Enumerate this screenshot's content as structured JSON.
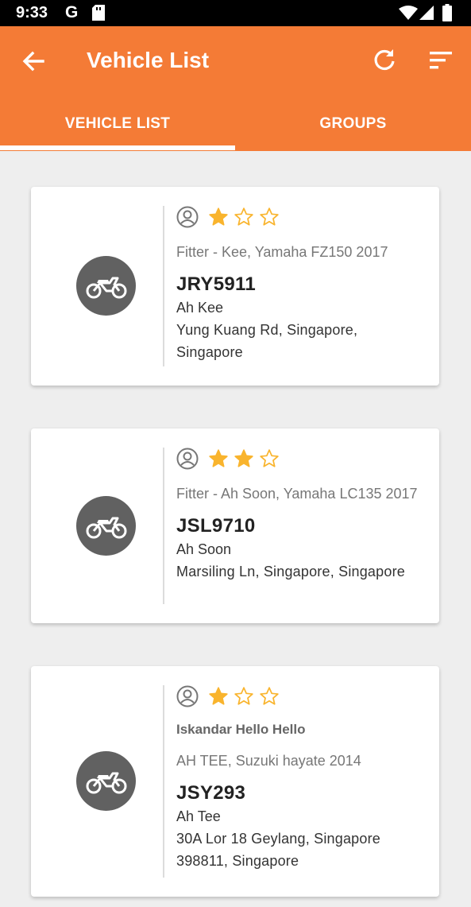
{
  "status_bar": {
    "time": "9:33",
    "g_label": "G",
    "icons": [
      "sd-card-icon",
      "wifi-icon",
      "signal-icon",
      "battery-icon"
    ]
  },
  "app_bar": {
    "title": "Vehicle List",
    "background_color": "#f47b36",
    "icons": [
      "back-arrow-icon",
      "refresh-icon",
      "sort-icon"
    ]
  },
  "tabs": [
    {
      "label": "VEHICLE LIST",
      "selected": true
    },
    {
      "label": "GROUPS",
      "selected": false
    }
  ],
  "vehicles": [
    {
      "rating": 1,
      "max_rating": 3,
      "group": "",
      "description": "Fitter - Kee, Yamaha FZ150 2017",
      "plate": "JRY5911",
      "owner": "Ah Kee",
      "address": "Yung Kuang Rd, Singapore, Singapore"
    },
    {
      "rating": 2,
      "max_rating": 3,
      "group": "",
      "description": "Fitter - Ah Soon, Yamaha LC135 2017",
      "plate": "JSL9710",
      "owner": "Ah Soon",
      "address": "Marsiling Ln, Singapore, Singapore"
    },
    {
      "rating": 1,
      "max_rating": 3,
      "group": "Iskandar Hello Hello",
      "description": "AH TEE, Suzuki hayate 2014",
      "plate": "JSY293",
      "owner": "Ah Tee",
      "address": "30A Lor 18 Geylang, Singapore 398811, Singapore"
    }
  ],
  "colors": {
    "accent": "#f47b36",
    "star": "#f9b42d",
    "avatar_bg": "#616161"
  }
}
